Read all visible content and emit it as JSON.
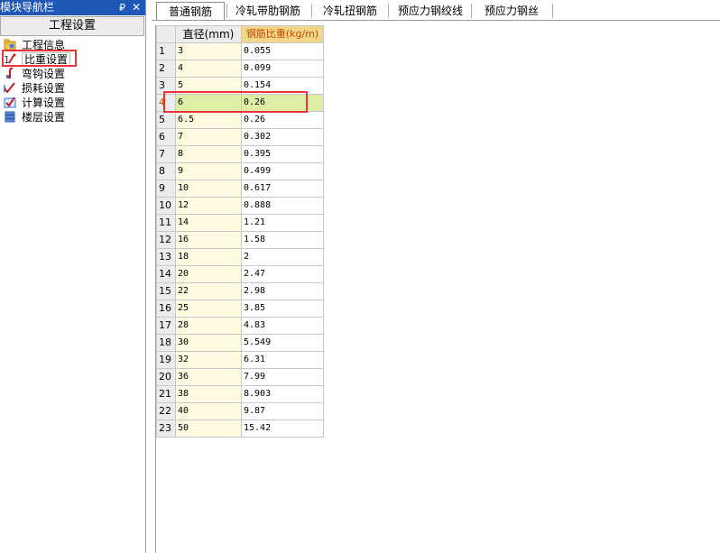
{
  "nav": {
    "title": "模块导航栏",
    "pin_glyph": "₽",
    "close_glyph": "✕",
    "header": "工程设置",
    "items": [
      {
        "label": "工程信息",
        "icon": "folder-info-icon"
      },
      {
        "label": "比重设置",
        "icon": "weight-ratio-icon",
        "selected": true
      },
      {
        "label": "弯钩设置",
        "icon": "hook-icon"
      },
      {
        "label": "损耗设置",
        "icon": "loss-icon"
      },
      {
        "label": "计算设置",
        "icon": "calc-icon"
      },
      {
        "label": "楼层设置",
        "icon": "floor-icon"
      }
    ]
  },
  "tabs": [
    {
      "label": "普通钢筋",
      "active": true
    },
    {
      "label": "冷轧带肋钢筋"
    },
    {
      "label": "冷轧扭钢筋"
    },
    {
      "label": "预应力钢绞线"
    },
    {
      "label": "预应力钢丝"
    }
  ],
  "grid": {
    "headers": {
      "diameter": "直径(mm)",
      "ratio": "钢筋比重(kg/m)"
    },
    "current_row": 4,
    "rows": [
      {
        "no": "1",
        "diameter": "3",
        "ratio": "0.055"
      },
      {
        "no": "2",
        "diameter": "4",
        "ratio": "0.099"
      },
      {
        "no": "3",
        "diameter": "5",
        "ratio": "0.154"
      },
      {
        "no": "4",
        "diameter": "6",
        "ratio": "0.26"
      },
      {
        "no": "5",
        "diameter": "6.5",
        "ratio": "0.26"
      },
      {
        "no": "6",
        "diameter": "7",
        "ratio": "0.302"
      },
      {
        "no": "7",
        "diameter": "8",
        "ratio": "0.395"
      },
      {
        "no": "8",
        "diameter": "9",
        "ratio": "0.499"
      },
      {
        "no": "9",
        "diameter": "10",
        "ratio": "0.617"
      },
      {
        "no": "10",
        "diameter": "12",
        "ratio": "0.888"
      },
      {
        "no": "11",
        "diameter": "14",
        "ratio": "1.21"
      },
      {
        "no": "12",
        "diameter": "16",
        "ratio": "1.58"
      },
      {
        "no": "13",
        "diameter": "18",
        "ratio": "2"
      },
      {
        "no": "14",
        "diameter": "20",
        "ratio": "2.47"
      },
      {
        "no": "15",
        "diameter": "22",
        "ratio": "2.98"
      },
      {
        "no": "16",
        "diameter": "25",
        "ratio": "3.85"
      },
      {
        "no": "17",
        "diameter": "28",
        "ratio": "4.83"
      },
      {
        "no": "18",
        "diameter": "30",
        "ratio": "5.549"
      },
      {
        "no": "19",
        "diameter": "32",
        "ratio": "6.31"
      },
      {
        "no": "20",
        "diameter": "36",
        "ratio": "7.99"
      },
      {
        "no": "21",
        "diameter": "38",
        "ratio": "8.903"
      },
      {
        "no": "22",
        "diameter": "40",
        "ratio": "9.87"
      },
      {
        "no": "23",
        "diameter": "50",
        "ratio": "15.42"
      }
    ]
  },
  "colors": {
    "titlebar": "#1f57b6",
    "diameter_column_bg": "#fffbe0",
    "ratio_header_bg": "#f2d68a",
    "current_row_bg": "#dfeea7",
    "annotation_red": "#e8353a"
  }
}
